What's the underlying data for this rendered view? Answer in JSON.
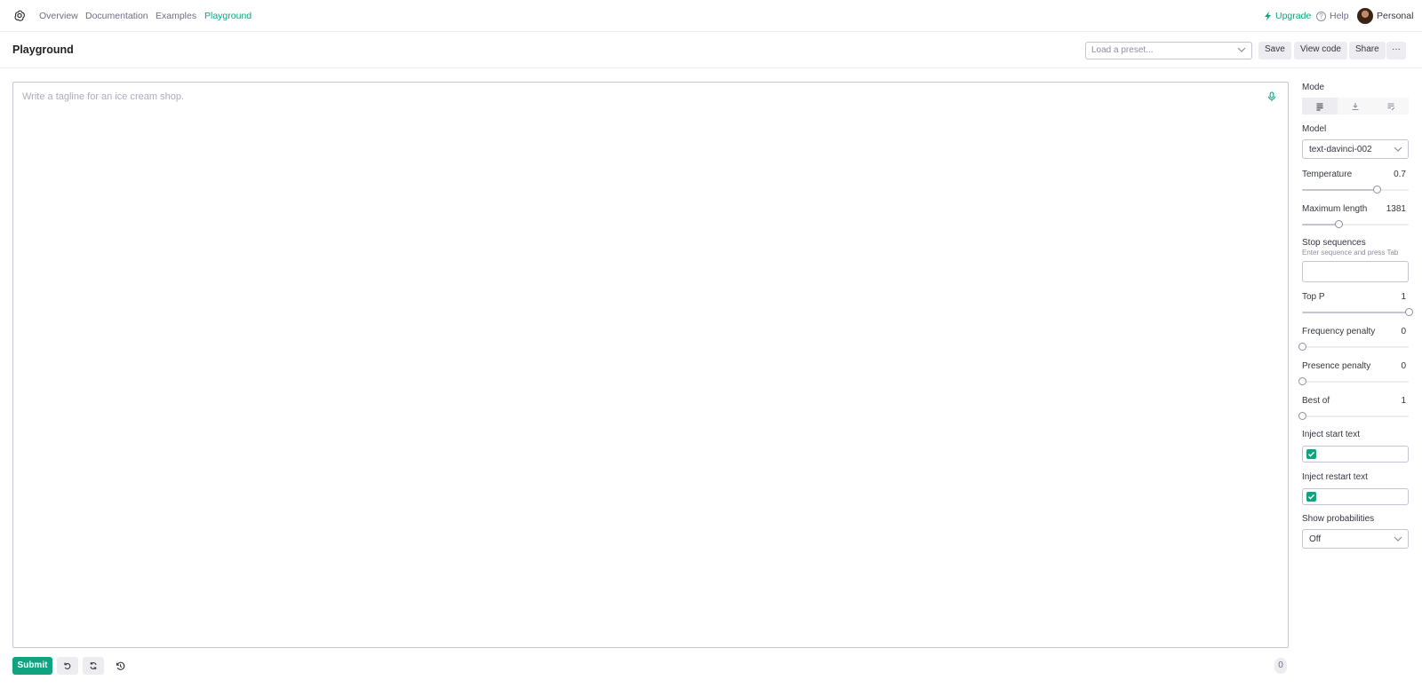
{
  "nav": {
    "logo": "openai-logo-icon",
    "links": [
      "Overview",
      "Documentation",
      "Examples",
      "Playground"
    ],
    "active": "Playground",
    "upgrade": "Upgrade",
    "help": "Help",
    "help_glyph": "?",
    "account": "Personal"
  },
  "header": {
    "title": "Playground",
    "preset_placeholder": "Load a preset...",
    "save": "Save",
    "view_code": "View code",
    "share": "Share",
    "more": "···"
  },
  "editor": {
    "placeholder": "Write a tagline for an ice cream shop.",
    "value": ""
  },
  "bottom": {
    "submit": "Submit",
    "token_count": "0"
  },
  "panel": {
    "mode": {
      "label": "Mode",
      "options": [
        "complete-icon",
        "insert-icon",
        "edit-icon"
      ],
      "selected": 0
    },
    "model": {
      "label": "Model",
      "value": "text-davinci-002"
    },
    "temperature": {
      "label": "Temperature",
      "value": "0.7",
      "fraction": 0.7
    },
    "max_length": {
      "label": "Maximum length",
      "value": "1381",
      "fraction": 0.34
    },
    "stop_sequences": {
      "label": "Stop sequences",
      "hint": "Enter sequence and press Tab",
      "value": ""
    },
    "top_p": {
      "label": "Top P",
      "value": "1",
      "fraction": 1.0
    },
    "frequency_penalty": {
      "label": "Frequency penalty",
      "value": "0",
      "fraction": 0
    },
    "presence_penalty": {
      "label": "Presence penalty",
      "value": "0",
      "fraction": 0
    },
    "best_of": {
      "label": "Best of",
      "value": "1",
      "fraction": 0
    },
    "inject_start": {
      "label": "Inject start text",
      "checked": true,
      "value": ""
    },
    "inject_restart": {
      "label": "Inject restart text",
      "checked": true,
      "value": ""
    },
    "show_probabilities": {
      "label": "Show probabilities",
      "value": "Off"
    }
  },
  "colors": {
    "accent": "#10a37f",
    "border": "#c5c5d2",
    "muted": "#6e6e80",
    "button_bg": "#ececf1"
  }
}
